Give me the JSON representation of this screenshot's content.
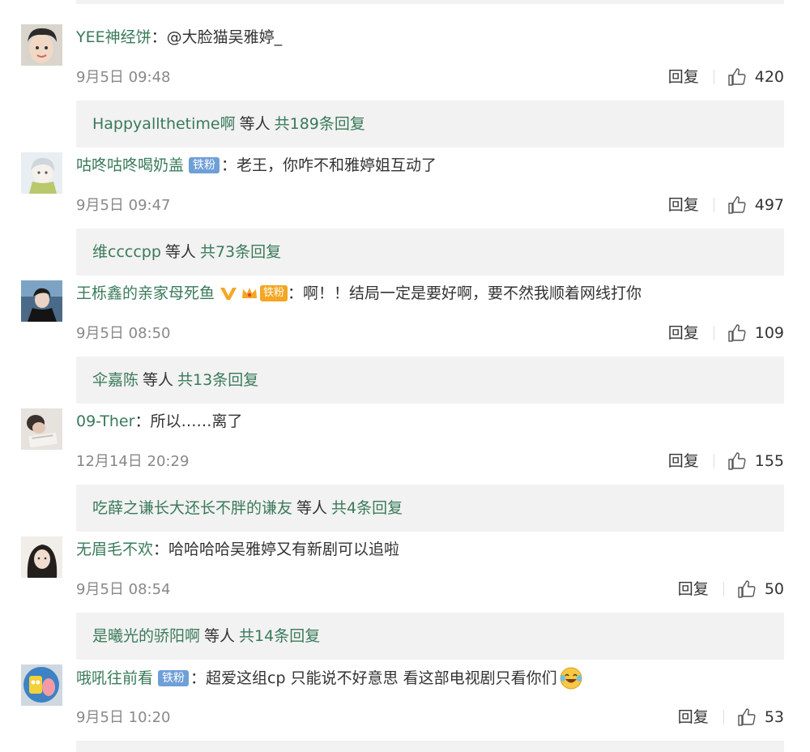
{
  "comments": [
    {
      "username": "YEE神经饼",
      "text": "@大脸猫吴雅婷_",
      "badge": "",
      "time": "9月5日 09:48",
      "reply_label": "回复",
      "likes": "420",
      "replies": {
        "names": "Happyallthetime啊",
        "middle": "等人",
        "count": "共189条回复"
      }
    },
    {
      "username": "咕咚咕咚喝奶盖",
      "text": "老王，你咋不和雅婷姐互动了",
      "badge": "铁粉",
      "time": "9月5日 09:47",
      "reply_label": "回复",
      "likes": "497",
      "replies": {
        "names": "维ccccpp",
        "middle": "等人",
        "count": "共73条回复"
      }
    },
    {
      "username": "王栎鑫的亲家母死鱼",
      "text": "啊！！结局一定是要好啊，要不然我顺着网线打你",
      "badge": "铁粉",
      "time": "9月5日 08:50",
      "reply_label": "回复",
      "likes": "109",
      "replies": {
        "names": "伞嘉陈",
        "middle": "等人",
        "count": "共13条回复"
      }
    },
    {
      "username": "09-Ther",
      "text": "所以……离了",
      "badge": "",
      "time": "12月14日 20:29",
      "reply_label": "回复",
      "likes": "155",
      "replies": {
        "names": "吃薛之谦长大还长不胖的谦友",
        "middle": "等人",
        "count": "共4条回复"
      }
    },
    {
      "username": "无眉毛不欢",
      "text": "哈哈哈哈吴雅婷又有新剧可以追啦",
      "badge": "",
      "time": "9月5日 08:54",
      "reply_label": "回复",
      "likes": "50",
      "replies": {
        "names": "是曦光的骄阳啊",
        "middle": "等人",
        "count": "共14条回复"
      }
    },
    {
      "username": "哦吼往前看",
      "text": "超爱这组cp  只能说不好意思 看这部电视剧只看你们",
      "badge": "铁粉",
      "time": "9月5日 10:20",
      "reply_label": "回复",
      "likes": "53",
      "replies": {
        "names": "",
        "middle": "",
        "count": ""
      }
    }
  ],
  "colors": {
    "username": "#3a7a5a",
    "badge_blue": "#6f9fd8",
    "badge_orange": "#f5a623",
    "reply_bg": "#f2f2f2"
  },
  "icons": {
    "like": "thumbs-up-icon",
    "verified": "v-verified-icon",
    "crown": "crown-badge-icon",
    "emoji": "laughing-tears-emoji"
  }
}
